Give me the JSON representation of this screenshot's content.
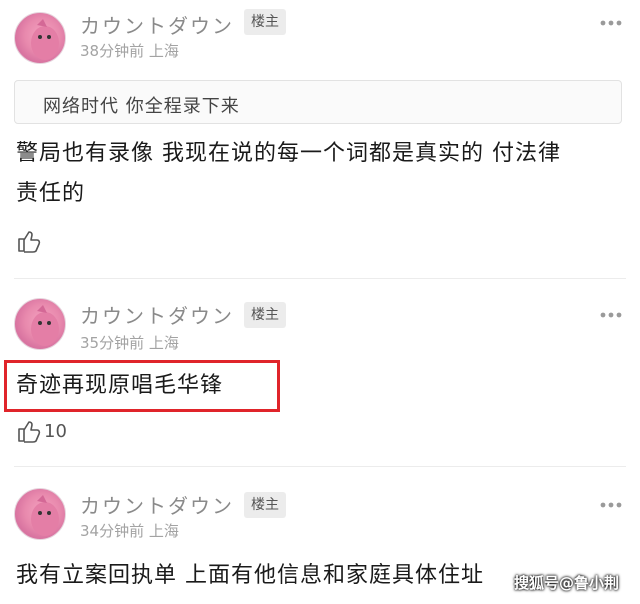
{
  "comments": [
    {
      "username": "カウントダウン",
      "badge": "楼主",
      "time": "38分钟前",
      "location": "上海",
      "quote": "网络时代 你全程录下来",
      "body_line1": "警局也有录像 我现在说的每一个词都是真实的 付法律",
      "body_line2": "责任的",
      "likes": ""
    },
    {
      "username": "カウントダウン",
      "badge": "楼主",
      "time": "35分钟前",
      "location": "上海",
      "body_line1": "奇迹再现原唱毛华锋",
      "likes": "10"
    },
    {
      "username": "カウントダウン",
      "badge": "楼主",
      "time": "34分钟前",
      "location": "上海",
      "body_line1": "我有立案回执单 上面有他信息和家庭具体住址"
    }
  ],
  "watermark": "搜狐号@鲁小荆",
  "colors": {
    "highlight": "#e0242a",
    "meta": "#a3a3a3",
    "username": "#8a8a8a"
  },
  "icons": {
    "more": "more-horizontal-icon",
    "like": "thumbs-up-icon"
  }
}
